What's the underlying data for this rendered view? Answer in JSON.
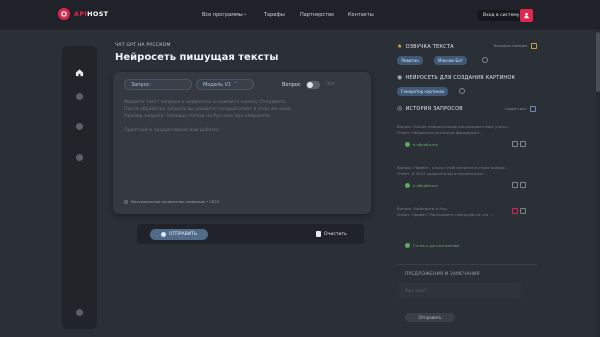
{
  "header": {
    "logo_api": "API",
    "logo_host": "HOST",
    "nav": [
      "Все программы",
      "Тарифы",
      "Партнерство",
      "Контакты"
    ],
    "login_label": "Вход в систему"
  },
  "main": {
    "breadcrumb": "ЧАТ GPT НА РУССКОМ",
    "title": "Нейросеть пишущая тексты",
    "request_pill": "Запрос:",
    "model_pill": "Модель V1",
    "toggle_label": "Вопрос",
    "toggle_alt": "Чат",
    "placeholder_lines": [
      "Введите текст запроса к нейросети и нажмите кнопку Отправить.",
      "После обработки запроса вы увидите готовый ответ в этом же окне.",
      "Пример запроса: Напиши статью на Русском про нейросети",
      "",
      "Приятной и продуктивной вам работы!"
    ],
    "max_chars": "Максимальное количество символов • 2020",
    "send_label": "ОТПРАВИТЬ",
    "clear_label": "Очистить"
  },
  "right": {
    "voice_title": "ОЗВУЧКА ТЕКСТА",
    "voice_side": "Большая галерея",
    "voice_tags": [
      "Левитан",
      "Максим Бот"
    ],
    "image_title": "НЕЙРОСЕТЬ ДЛЯ СОЗДАНИЯ КАРТИНОК",
    "image_tags": [
      "Генератор картинок"
    ],
    "history_title": "ИСТОРИЯ ЗАПРОСОВ",
    "history_side": "Скрыть все",
    "history": [
      {
        "l1": "Вопрос: Какие нейросетевые концепции стоит учить...",
        "l2": "Ответ: Нейросети эксперты формируют...",
        "status": "в обработке"
      },
      {
        "l1": "Вопрос: Привет, я хочу чтоб написал в стиле вопрос...",
        "l2": "Ответ: В 2013 уверенно вы отличительно ...",
        "status": "в обработке"
      },
      {
        "l1": "Вопрос: Выберите и Как.",
        "l2": "Ответ: Привет! Расскажите пожалуйста что ...",
        "status": "Готов к рассмотрению"
      }
    ],
    "feedback_title": "ПРЕДЛОЖЕНИЯ И ЗАМЕЧАНИЯ",
    "feedback_placeholder": "Ваш текст",
    "feedback_btn": "Отправить"
  },
  "colors": {
    "accent": "#e0264d",
    "blue": "#506b88",
    "bg": "#2b2f36"
  }
}
